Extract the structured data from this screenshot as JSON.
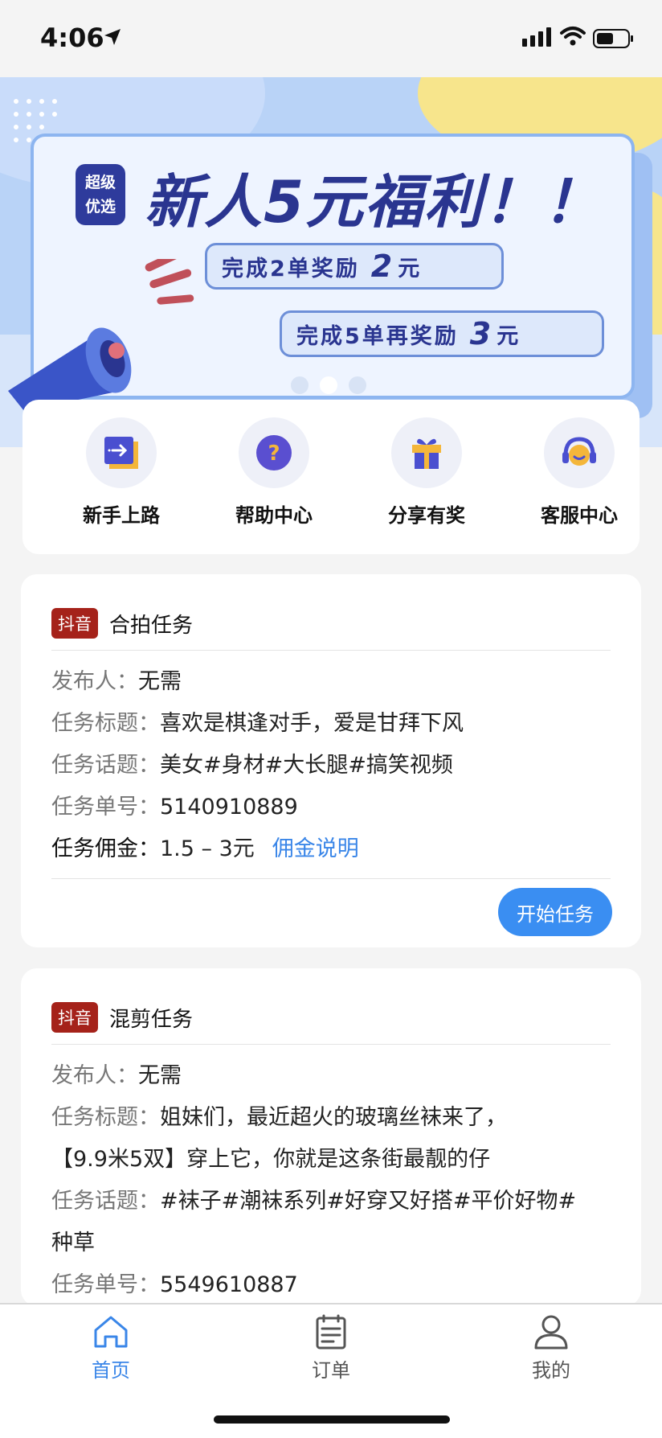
{
  "status": {
    "time": "4:06"
  },
  "banner": {
    "badge_line1": "超级",
    "badge_line2": "优选",
    "title": "新人5元福利！！",
    "bubble1_text": "完成2单奖励",
    "bubble1_amount": "2",
    "bubble1_unit": "元",
    "bubble2_text": "完成5单再奖励",
    "bubble2_amount": "3",
    "bubble2_unit": "元",
    "active_slide": 2
  },
  "quick": [
    {
      "label": "新手上路",
      "icon": "login-arrow-icon"
    },
    {
      "label": "帮助中心",
      "icon": "question-icon"
    },
    {
      "label": "分享有奖",
      "icon": "gift-icon"
    },
    {
      "label": "客服中心",
      "icon": "headset-icon"
    }
  ],
  "tasks": [
    {
      "tag": "抖音",
      "type": "合拍任务",
      "publisher_label": "发布人：",
      "publisher": "无需",
      "title_label": "任务标题：",
      "title": "喜欢是棋逢对手，爱是甘拜下风",
      "topic_label": "任务话题：",
      "topic": "美女#身材#大长腿#搞笑视频",
      "number_label": "任务单号：",
      "number": "5140910889",
      "commission_label": "任务佣金：",
      "commission": "1.5 – 3元",
      "commission_link": "佣金说明",
      "button": "开始任务"
    },
    {
      "tag": "抖音",
      "type": "混剪任务",
      "publisher_label": "发布人：",
      "publisher": "无需",
      "title_label": "任务标题：",
      "title_line1": "姐妹们，最近超火的玻璃丝袜来了，",
      "title_line2": "【9.9米5双】穿上它，你就是这条街最靓的仔",
      "topic_label": "任务话题：",
      "topic_line1": "#袜子#潮袜系列#好穿又好搭#平价好物#",
      "topic_line2": "种草",
      "number_label": "任务单号：",
      "number": "5549610887"
    }
  ],
  "tabbar": [
    {
      "label": "首页",
      "icon": "home-icon",
      "active": true
    },
    {
      "label": "订单",
      "icon": "orders-icon",
      "active": false
    },
    {
      "label": "我的",
      "icon": "profile-icon",
      "active": false
    }
  ],
  "colors": {
    "accent": "#3a86e8",
    "tag": "#a5221a",
    "banner_navy": "#2a3590"
  }
}
